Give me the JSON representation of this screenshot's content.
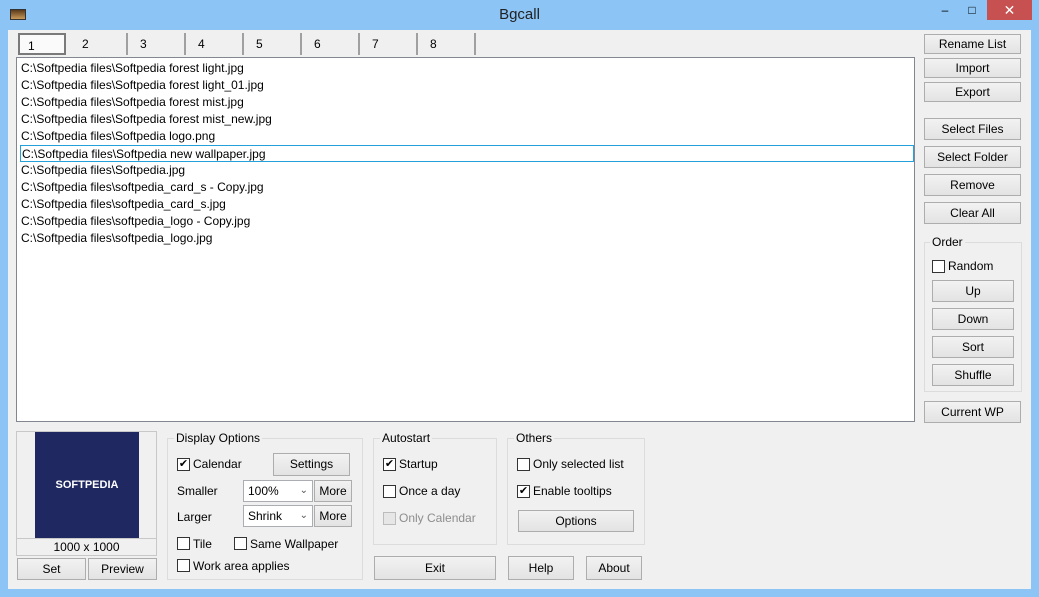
{
  "window": {
    "title": "Bgcall",
    "minimize": "–",
    "maximize": "□",
    "close": "✕"
  },
  "tabs": [
    "1",
    "2",
    "3",
    "4",
    "5",
    "6",
    "7",
    "8"
  ],
  "files": [
    "C:\\Softpedia files\\Softpedia forest light.jpg",
    "C:\\Softpedia files\\Softpedia forest light_01.jpg",
    "C:\\Softpedia files\\Softpedia forest mist.jpg",
    "C:\\Softpedia files\\Softpedia forest mist_new.jpg",
    "C:\\Softpedia files\\Softpedia logo.png",
    "C:\\Softpedia files\\Softpedia new wallpaper.jpg",
    "C:\\Softpedia files\\Softpedia.jpg",
    "C:\\Softpedia files\\softpedia_card_s - Copy.jpg",
    "C:\\Softpedia files\\softpedia_card_s.jpg",
    "C:\\Softpedia files\\softpedia_logo - Copy.jpg",
    "C:\\Softpedia files\\softpedia_logo.jpg"
  ],
  "selected_index": 5,
  "right": {
    "rename": "Rename List",
    "import": "Import",
    "export": "Export",
    "select_files": "Select Files",
    "select_folder": "Select Folder",
    "remove": "Remove",
    "clear_all": "Clear All",
    "order": "Order",
    "random": "Random",
    "up": "Up",
    "down": "Down",
    "sort": "Sort",
    "shuffle": "Shuffle",
    "current_wp": "Current WP"
  },
  "preview": {
    "logo": "SOFTPEDIA",
    "size": "1000 x 1000",
    "set": "Set",
    "preview": "Preview"
  },
  "display": {
    "title": "Display Options",
    "calendar": "Calendar",
    "settings": "Settings",
    "smaller": "Smaller",
    "smaller_value": "100%",
    "larger": "Larger",
    "larger_value": "Shrink",
    "more": "More",
    "tile": "Tile",
    "same_wallpaper": "Same Wallpaper",
    "work_area": "Work area applies"
  },
  "autostart": {
    "title": "Autostart",
    "startup": "Startup",
    "once": "Once a day",
    "only_calendar": "Only Calendar"
  },
  "others": {
    "title": "Others",
    "only_selected": "Only selected list",
    "tooltips": "Enable tooltips",
    "options": "Options"
  },
  "bottom": {
    "exit": "Exit",
    "help": "Help",
    "about": "About"
  }
}
